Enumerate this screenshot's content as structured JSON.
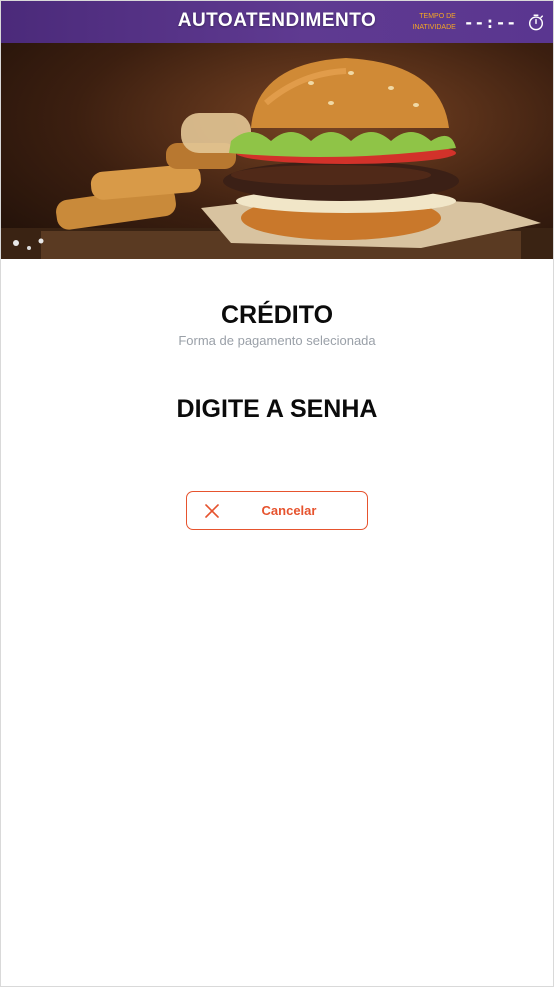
{
  "header": {
    "title": "AUTOATENDIMENTO",
    "inactivity_label": "TEMPO DE INATIVIDADE",
    "inactivity_timer": "--:--",
    "timer_icon": "stopwatch-icon"
  },
  "banner": {
    "image": "burger-and-fries-photo"
  },
  "payment": {
    "method": "CRÉDITO",
    "subtitle": "Forma de pagamento selecionada",
    "instruction": "DIGITE A SENHA"
  },
  "actions": {
    "cancel_label": "Cancelar",
    "cancel_icon": "close-icon"
  },
  "colors": {
    "header_bg": "#5a3690",
    "accent": "#e6532e",
    "timer_label": "#f5a623"
  }
}
